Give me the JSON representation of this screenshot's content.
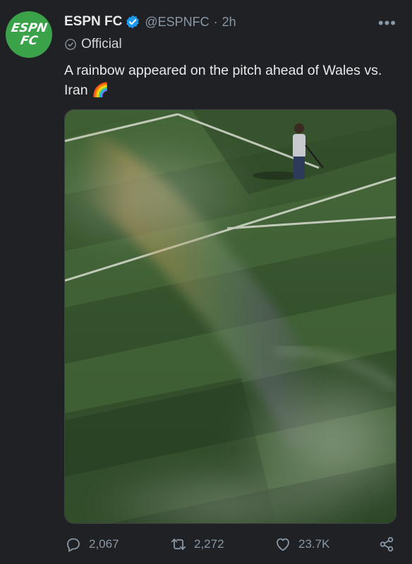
{
  "tweet": {
    "avatar_logo": "ESPN FC",
    "avatar_line1": "ESPN",
    "avatar_line2": "FC",
    "author_name": "ESPN FC",
    "handle": "@ESPNFC",
    "separator": "·",
    "time": "2h",
    "affiliation": "Official",
    "text": "A rainbow appeared on the pitch ahead of Wales vs. Iran 🌈",
    "verified_icon": "verified-badge-icon",
    "more_icon": "more-options-icon"
  },
  "actions": {
    "replies": "2,067",
    "retweets": "2,272",
    "likes": "23.7K"
  },
  "colors": {
    "background": "#202124",
    "avatar_green": "#3aa34a",
    "verified_blue": "#1d9bf0",
    "muted": "#8b98a5",
    "pitch_dark": "#2f4a2b",
    "pitch_light": "#45683a"
  }
}
